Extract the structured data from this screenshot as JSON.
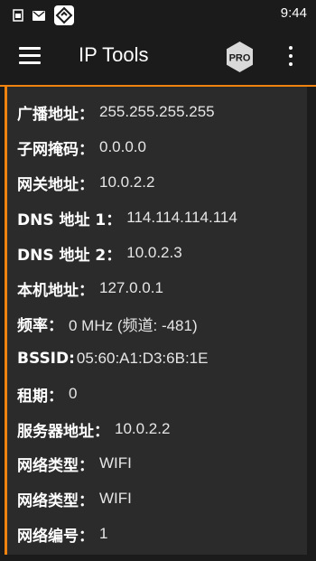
{
  "status_bar": {
    "time": "9:44",
    "icons": [
      "sim-card-icon",
      "mail-icon",
      "app-logo-icon"
    ]
  },
  "app_bar": {
    "title": "IP Tools",
    "pro_badge": "PRO",
    "icons": [
      "hamburger-menu-icon",
      "pro-badge-icon",
      "more-vertical-icon"
    ]
  },
  "colors": {
    "accent": "#f0820f",
    "background": "#1b1b1b",
    "panel": "#2b2b2b",
    "pro_badge": "#d9d9d9"
  },
  "info": {
    "rows": [
      {
        "label": "广播地址：",
        "value": "255.255.255.255"
      },
      {
        "label": "子网掩码：",
        "value": "0.0.0.0"
      },
      {
        "label": "网关地址：",
        "value": "10.0.2.2"
      },
      {
        "label": "DNS 地址 1：",
        "value": "114.114.114.114"
      },
      {
        "label": "DNS 地址 2：",
        "value": "10.0.2.3"
      },
      {
        "label": "本机地址：",
        "value": "127.0.0.1"
      },
      {
        "label": "频率：",
        "value": "0 MHz (频道: -481)"
      },
      {
        "label": "BSSID:",
        "value": "05:60:A1:D3:6B:1E"
      },
      {
        "label": "租期：",
        "value": "0"
      },
      {
        "label": "服务器地址：",
        "value": "10.0.2.2"
      },
      {
        "label": "网络类型：",
        "value": "WIFI"
      },
      {
        "label": "网络类型：",
        "value": "WIFI"
      },
      {
        "label": "网络编号：",
        "value": "1"
      }
    ]
  }
}
